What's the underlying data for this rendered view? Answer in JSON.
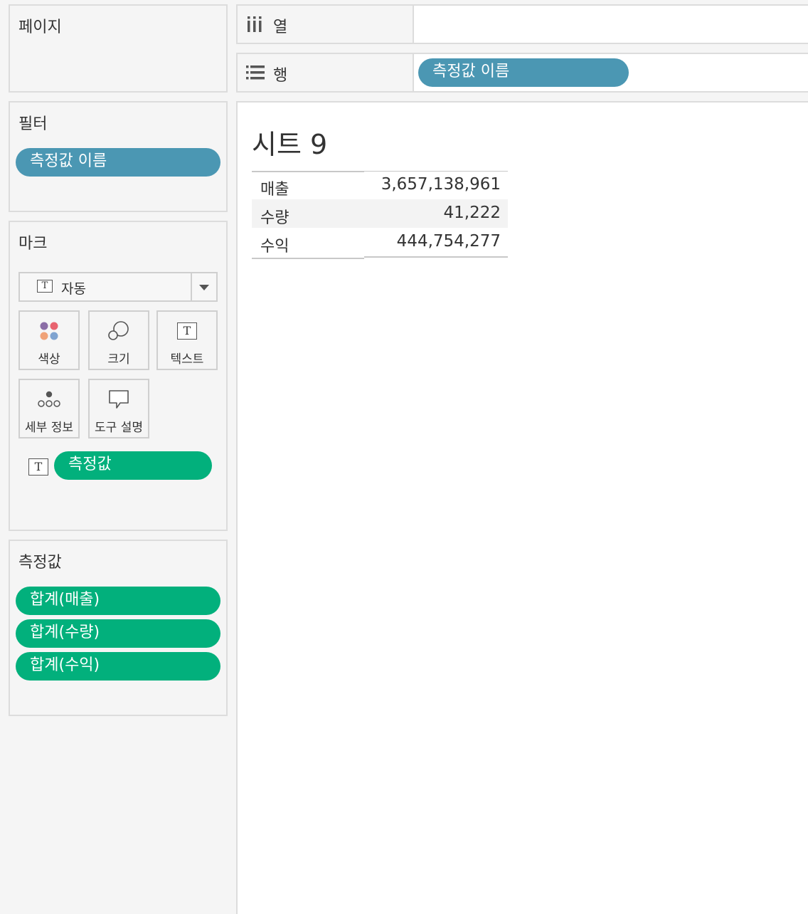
{
  "pages_panel": {
    "title": "페이지"
  },
  "filters_panel": {
    "title": "필터",
    "pills": [
      "측정값 이름"
    ]
  },
  "marks_panel": {
    "title": "마크",
    "mark_type": "자동",
    "buttons": {
      "color": "색상",
      "size": "크기",
      "text": "텍스트",
      "detail": "세부 정보",
      "tooltip": "도구 설명"
    },
    "text_pill": "측정값",
    "text_icon": "T"
  },
  "measure_values_panel": {
    "title": "측정값",
    "pills": [
      "합계(매출)",
      "합계(수량)",
      "합계(수익)"
    ]
  },
  "shelves": {
    "columns": {
      "label": "열"
    },
    "rows": {
      "label": "행",
      "pill": "측정값 이름"
    }
  },
  "view": {
    "sheet_title": "시트 9",
    "rows": [
      {
        "name": "매출",
        "value": "3,657,138,961"
      },
      {
        "name": "수량",
        "value": "41,222"
      },
      {
        "name": "수익",
        "value": "444,754,277"
      }
    ]
  },
  "colors": {
    "dimension_pill": "#4b97b3",
    "measure_pill": "#02b07c",
    "mark_color_dots": [
      "#8b6ea6",
      "#e8636f",
      "#f0a277",
      "#7fa3d0"
    ]
  }
}
